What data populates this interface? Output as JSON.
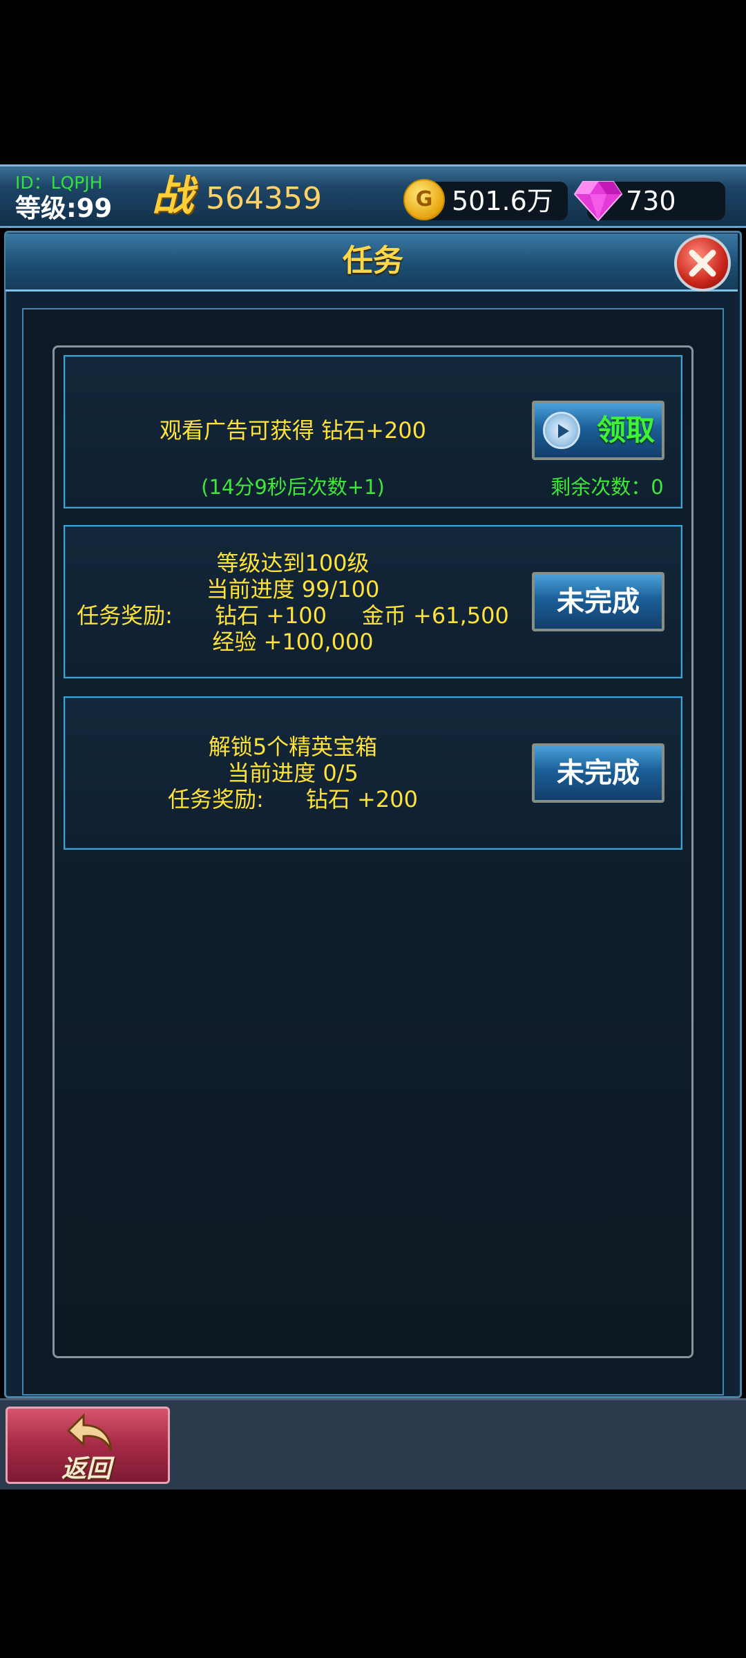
{
  "player": {
    "id": "ID：LQPJH",
    "level": "等级:99"
  },
  "power": {
    "icon_text": "战",
    "value": "564359"
  },
  "currency": {
    "gold": "501.6万",
    "gold_icon_text": "G",
    "diamonds": "730"
  },
  "dialog": {
    "title": "任务"
  },
  "tasks": [
    {
      "lines": [
        "观看广告可获得 钻石+200"
      ],
      "cooldown": "(14分9秒后次数+1)",
      "remaining": "剩余次数：0",
      "button": "领取"
    },
    {
      "lines": [
        "等级达到100级",
        "当前进度 99/100",
        "任务奖励:      钻石 +100     金币 +61,500",
        "经验 +100,000"
      ],
      "button": "未完成"
    },
    {
      "lines": [
        "解锁5个精英宝箱",
        "当前进度 0/5",
        "任务奖励:      钻石 +200"
      ],
      "button": "未完成"
    }
  ],
  "back_button": "返回",
  "colors": {
    "task_text": "#ffe23a",
    "green": "#3ee83a",
    "title": "#ffd84a"
  }
}
